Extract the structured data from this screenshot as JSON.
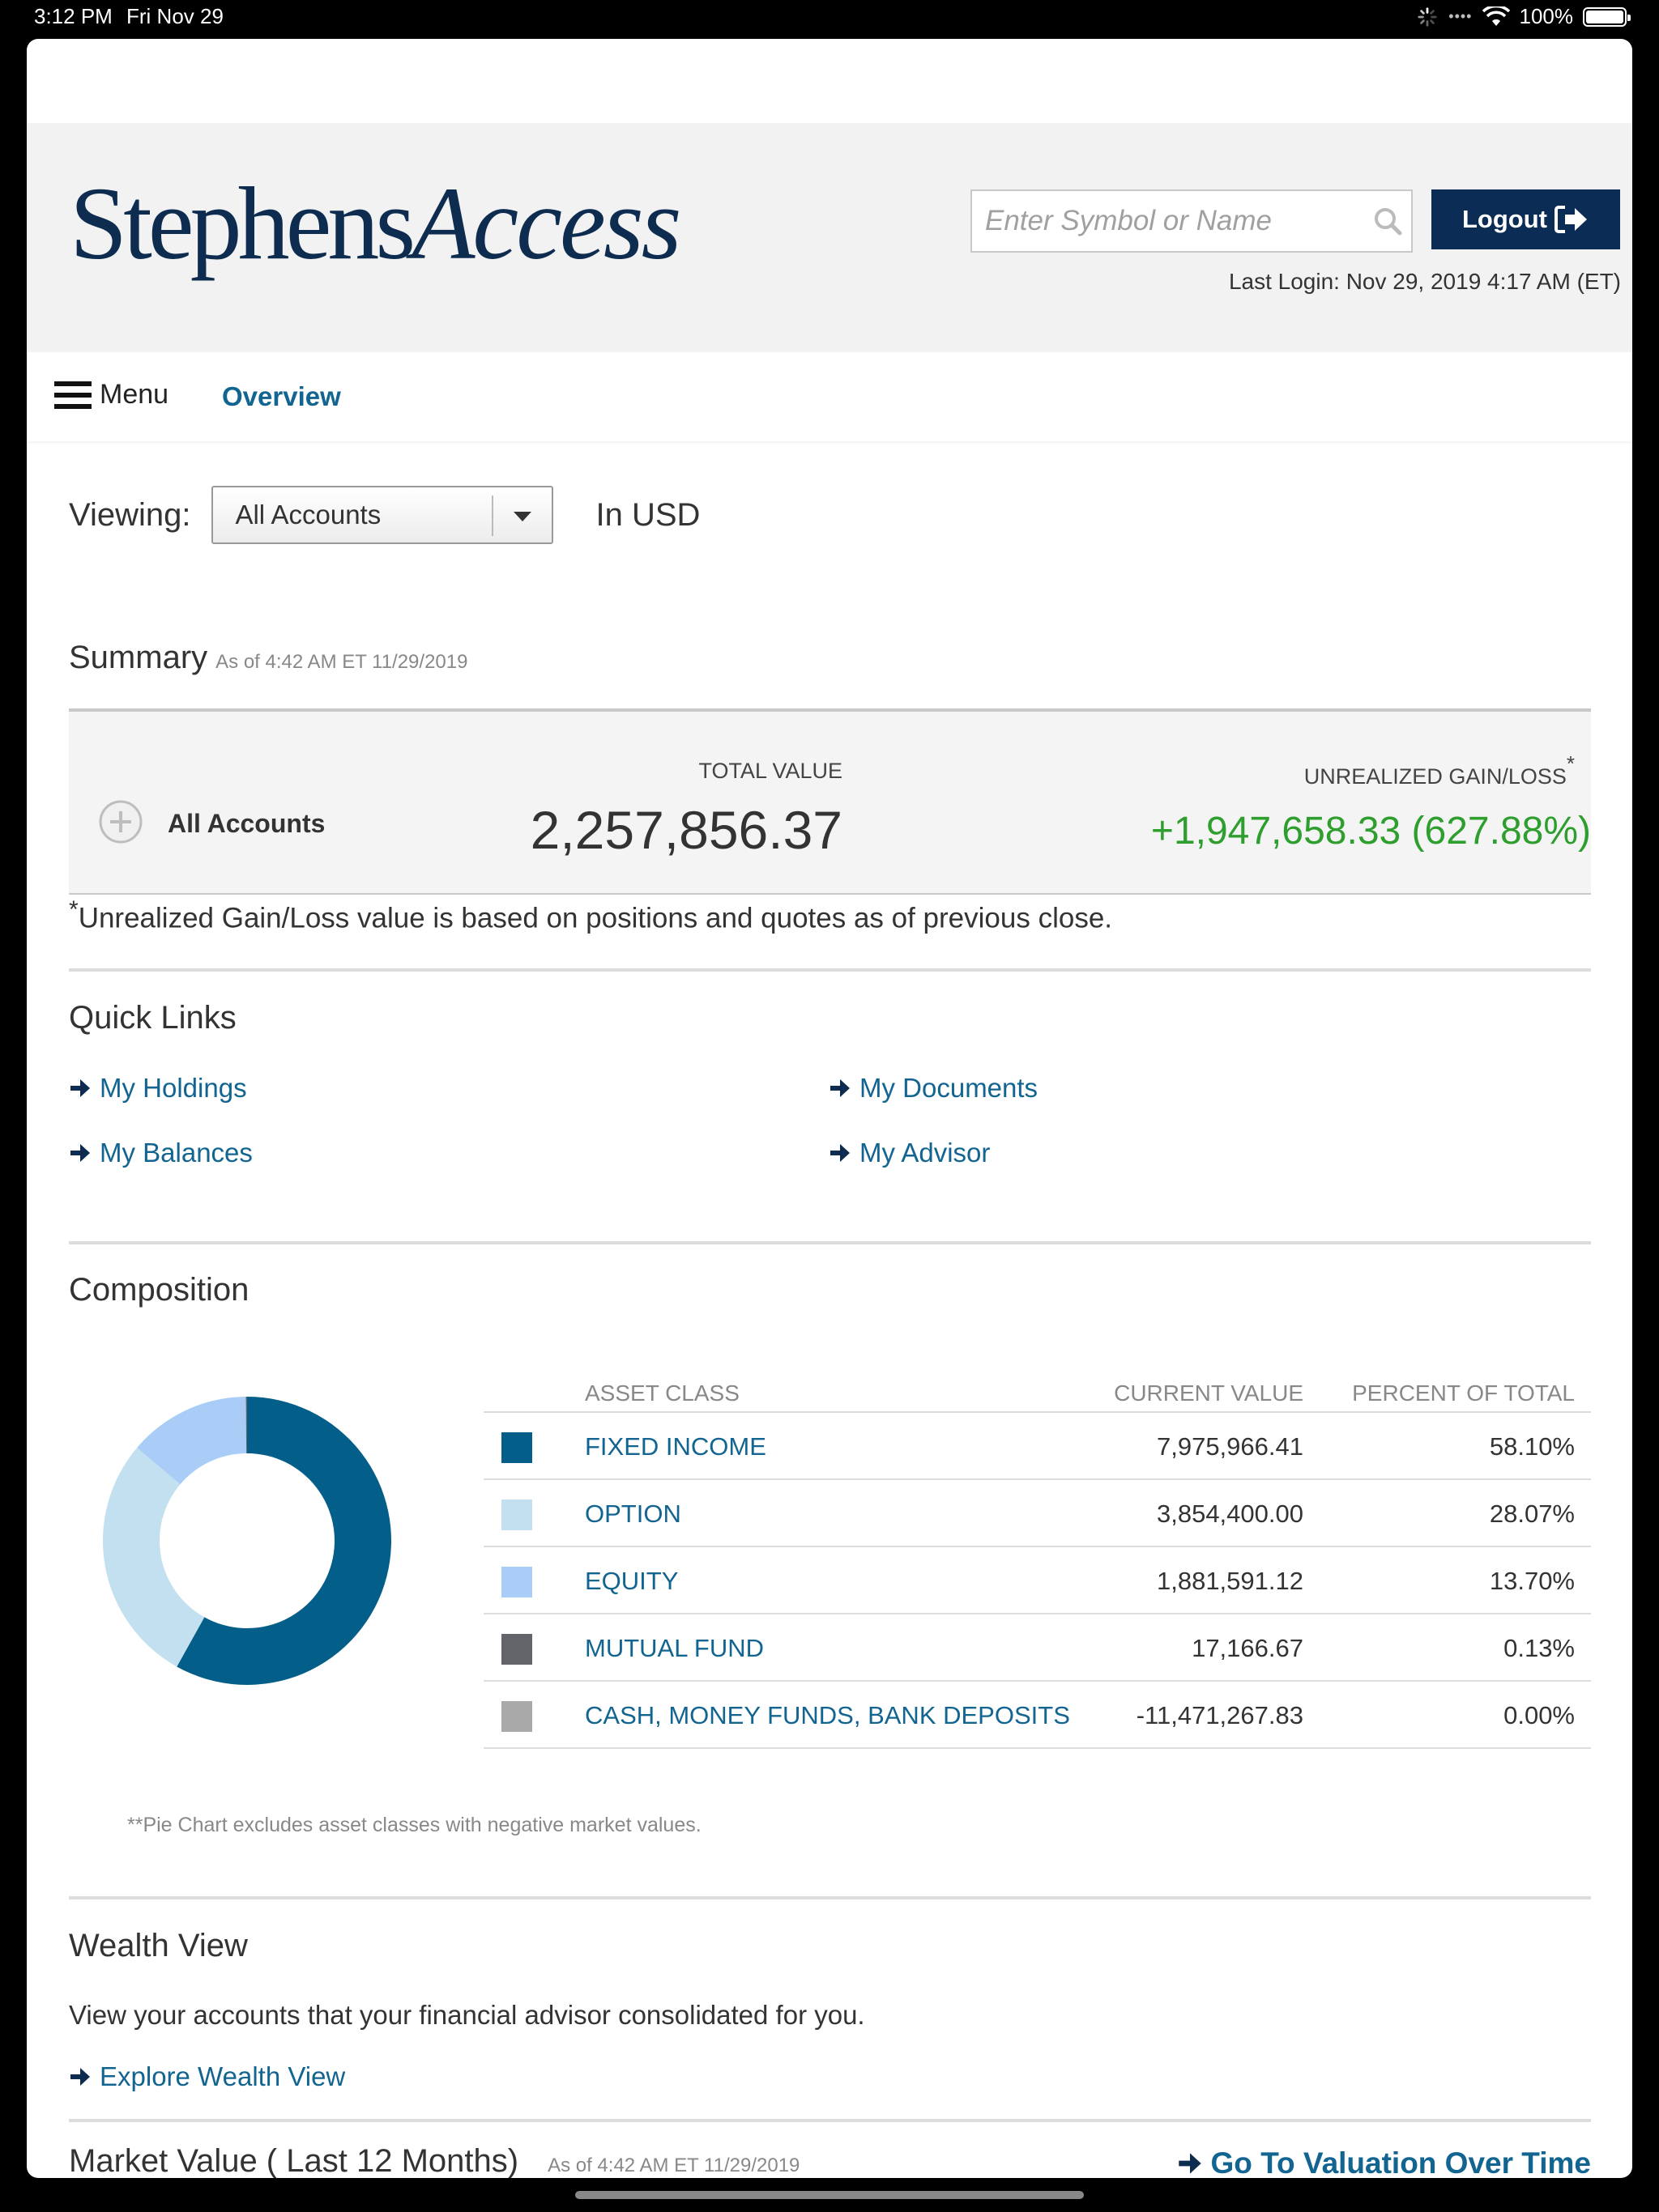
{
  "status_bar": {
    "time": "3:12 PM",
    "date": "Fri Nov 29",
    "battery": "100%"
  },
  "header": {
    "logo_main": "Stephens",
    "logo_italic": "Access",
    "search_placeholder": "Enter Symbol or Name",
    "logout_label": "Logout",
    "last_login": "Last Login: Nov 29, 2019 4:17 AM (ET)"
  },
  "nav": {
    "menu_label": "Menu",
    "overview_label": "Overview"
  },
  "viewing": {
    "label": "Viewing:",
    "selected": "All Accounts",
    "currency": "In USD"
  },
  "summary": {
    "title": "Summary",
    "as_of": "As of 4:42 AM ET 11/29/2019",
    "account_label": "All Accounts",
    "total_value_label": "TOTAL VALUE",
    "total_value": "2,257,856.37",
    "gain_label": "UNREALIZED GAIN/LOSS",
    "gain_marker": "*",
    "gain_value": "+1,947,658.33 (627.88%)",
    "gain_color": "#2e9e2e",
    "footnote_marker": "*",
    "footnote": "Unrealized Gain/Loss value is based on positions and quotes as of previous close."
  },
  "quick_links": {
    "title": "Quick Links",
    "items": [
      {
        "label": "My Holdings"
      },
      {
        "label": "My Documents"
      },
      {
        "label": "My Balances"
      },
      {
        "label": "My Advisor"
      }
    ]
  },
  "composition": {
    "title": "Composition",
    "headers": {
      "asset_class": "ASSET CLASS",
      "current_value": "CURRENT VALUE",
      "percent": "PERCENT OF TOTAL"
    },
    "rows": [
      {
        "asset": "FIXED INCOME",
        "value": "7,975,966.41",
        "percent": "58.10%",
        "color": "#045e8a"
      },
      {
        "asset": "OPTION",
        "value": "3,854,400.00",
        "percent": "28.07%",
        "color": "#c3e0f0"
      },
      {
        "asset": "EQUITY",
        "value": "1,881,591.12",
        "percent": "13.70%",
        "color": "#a9cdf7"
      },
      {
        "asset": "MUTUAL FUND",
        "value": "17,166.67",
        "percent": "0.13%",
        "color": "#636469"
      },
      {
        "asset": "CASH, MONEY FUNDS, BANK DEPOSITS",
        "value": "-11,471,267.83",
        "percent": "0.00%",
        "color": "#a9a9a9"
      }
    ],
    "pie_note": "**Pie Chart excludes asset classes with negative market values."
  },
  "chart_data": {
    "type": "pie",
    "donut": true,
    "categories": [
      "FIXED INCOME",
      "OPTION",
      "EQUITY",
      "MUTUAL FUND"
    ],
    "values": [
      58.1,
      28.07,
      13.7,
      0.13
    ],
    "colors": [
      "#045e8a",
      "#c3e0f0",
      "#a9cdf7",
      "#636469"
    ]
  },
  "wealth_view": {
    "title": "Wealth View",
    "description": "View your accounts that your financial advisor consolidated for you.",
    "link": "Explore Wealth View"
  },
  "market_value": {
    "title": "Market Value ( Last 12 Months)",
    "as_of": "As of 4:42 AM ET 11/29/2019",
    "link": "Go To Valuation Over Time"
  }
}
